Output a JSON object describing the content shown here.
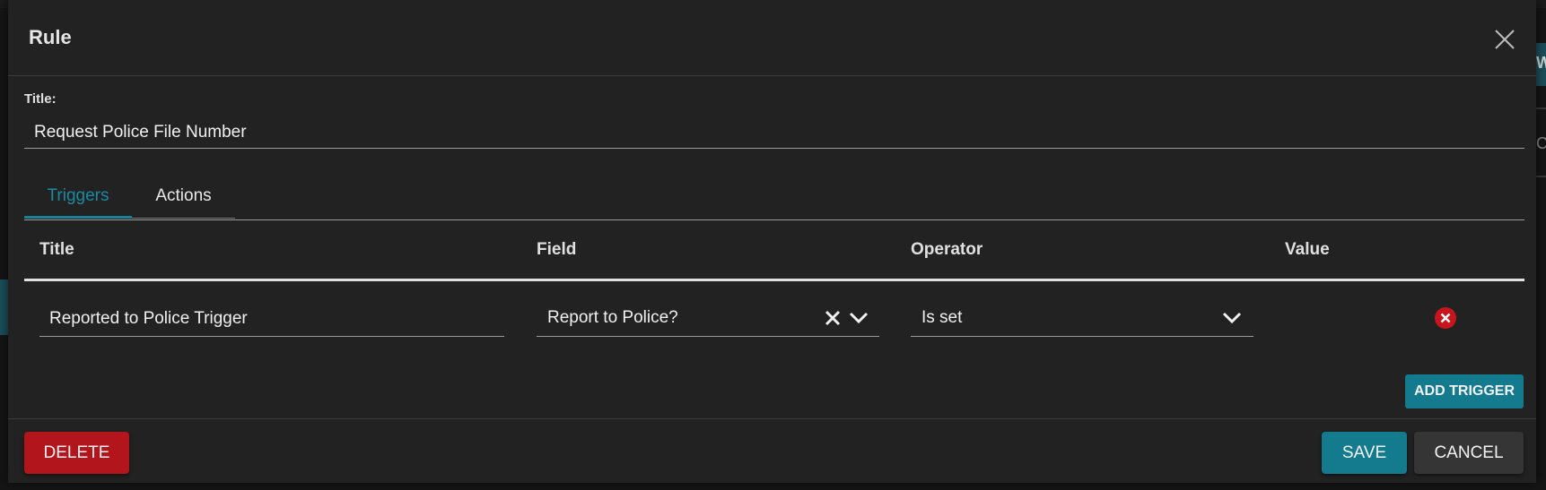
{
  "dialog": {
    "title": "Rule"
  },
  "form": {
    "title_label": "Title:",
    "title_value": "Request Police File Number"
  },
  "tabs": [
    {
      "label": "Triggers",
      "active": true
    },
    {
      "label": "Actions",
      "active": false
    }
  ],
  "table": {
    "columns": [
      "Title",
      "Field",
      "Operator",
      "Value"
    ],
    "rows": [
      {
        "title": "Reported to Police Trigger",
        "field": "Report to Police?",
        "operator": "Is set",
        "value": ""
      }
    ]
  },
  "buttons": {
    "add_trigger": "ADD TRIGGER",
    "delete": "DELETE",
    "save": "SAVE",
    "cancel": "CANCEL"
  },
  "background": {
    "right_edge_text": "W",
    "right_edge_text2": "C"
  },
  "colors": {
    "accent": "#147a8e",
    "danger": "#b3151c",
    "surface": "#222222",
    "remove_icon": "#c8151d"
  },
  "icons": {
    "close": "close-icon",
    "clear": "clear-icon",
    "chevron": "chevron-down-icon",
    "remove": "remove-circle-icon"
  }
}
